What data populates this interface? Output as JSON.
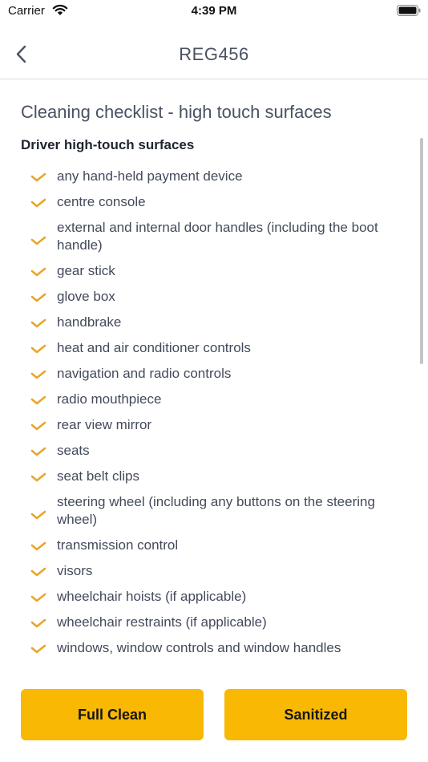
{
  "status_bar": {
    "carrier": "Carrier",
    "time": "4:39 PM"
  },
  "nav": {
    "title": "REG456"
  },
  "page": {
    "title": "Cleaning checklist - high touch surfaces",
    "section_heading": "Driver high-touch surfaces"
  },
  "checklist": [
    "any hand-held payment device",
    "centre console",
    "external and internal door handles (including the boot handle)",
    "gear stick",
    "glove box",
    "handbrake",
    "heat and air conditioner controls",
    "navigation and radio controls",
    "radio mouthpiece",
    "rear view mirror",
    "seats",
    "seat belt clips",
    "steering wheel (including any buttons on the steering wheel)",
    "transmission control",
    "visors",
    "wheelchair hoists (if applicable)",
    "wheelchair restraints (if applicable)",
    "windows, window controls and window handles"
  ],
  "buttons": {
    "full_clean": "Full Clean",
    "sanitized": "Sanitized"
  },
  "colors": {
    "accent": "#f8b803",
    "check": "#e8a628"
  }
}
